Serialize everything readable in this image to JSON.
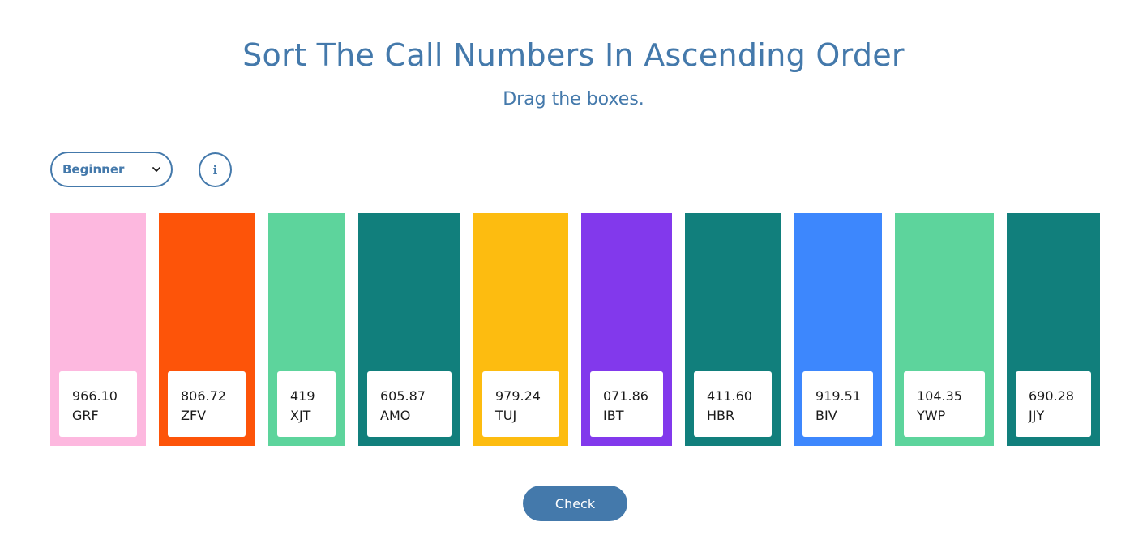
{
  "header": {
    "title": "Sort The Call Numbers In Ascending Order",
    "subtitle": "Drag the boxes."
  },
  "controls": {
    "level_selected": "Beginner",
    "info_label": "i",
    "check_label": "Check"
  },
  "colors": {
    "accent": "#4479ab"
  },
  "books": [
    {
      "number": "966.10",
      "code": "GRF",
      "color": "#fdb8df"
    },
    {
      "number": "806.72",
      "code": "ZFV",
      "color": "#fd5409"
    },
    {
      "number": "419",
      "code": "XJT",
      "color": "#5dd49c"
    },
    {
      "number": "605.87",
      "code": "AMO",
      "color": "#117f7c"
    },
    {
      "number": "979.24",
      "code": "TUJ",
      "color": "#fdbc10"
    },
    {
      "number": "071.86",
      "code": "IBT",
      "color": "#8239ec"
    },
    {
      "number": "411.60",
      "code": "HBR",
      "color": "#117f7c"
    },
    {
      "number": "919.51",
      "code": "BIV",
      "color": "#3d87fd"
    },
    {
      "number": "104.35",
      "code": "YWP",
      "color": "#5dd49c"
    },
    {
      "number": "690.28",
      "code": "JJY",
      "color": "#117f7c"
    }
  ]
}
